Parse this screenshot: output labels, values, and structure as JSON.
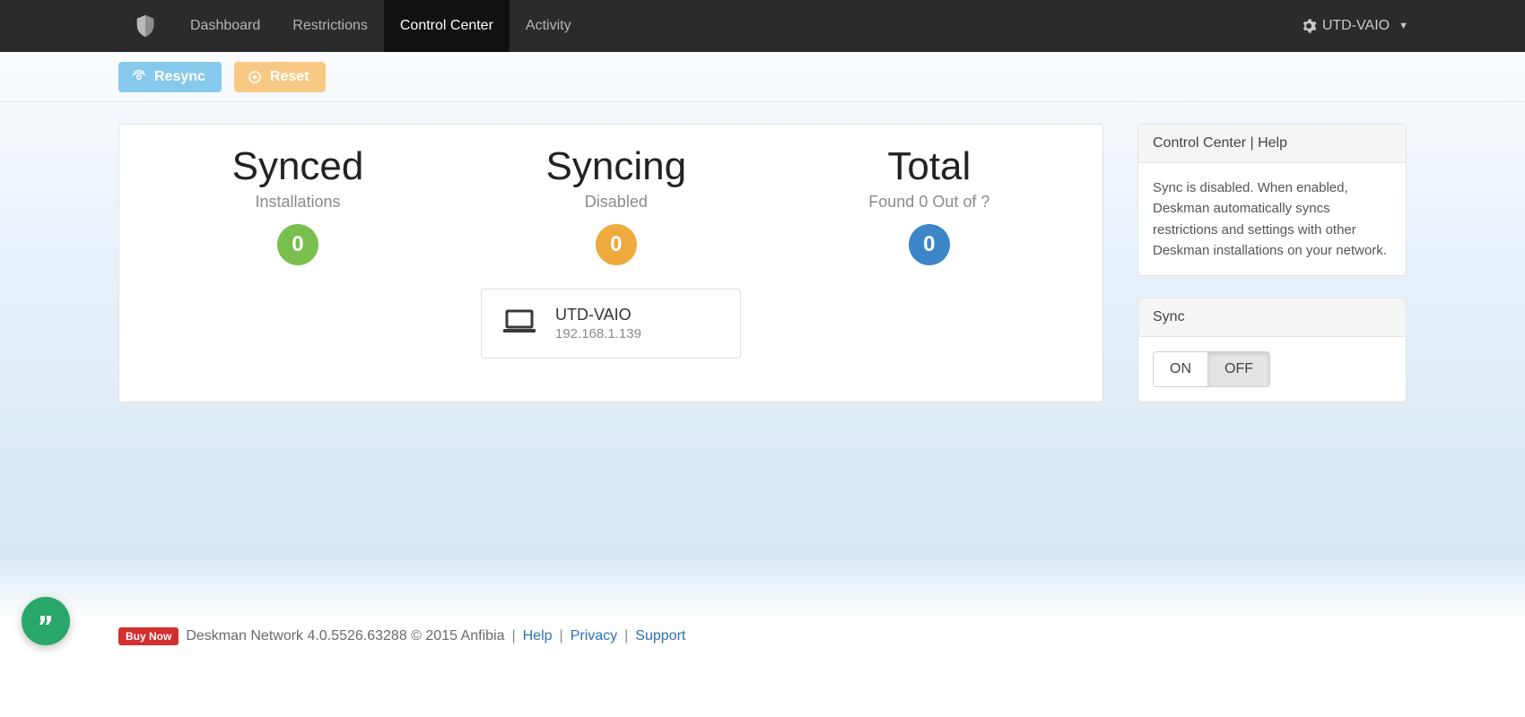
{
  "nav": {
    "items": [
      "Dashboard",
      "Restrictions",
      "Control Center",
      "Activity"
    ],
    "active_index": 2,
    "user_label": "UTD-VAIO"
  },
  "toolbar": {
    "resync_label": "Resync",
    "reset_label": "Reset"
  },
  "stats": {
    "synced": {
      "title": "Synced",
      "sub": "Installations",
      "value": "0"
    },
    "syncing": {
      "title": "Syncing",
      "sub": "Disabled",
      "value": "0"
    },
    "total": {
      "title": "Total",
      "sub": "Found 0 Out of ?",
      "value": "0"
    }
  },
  "device": {
    "name": "UTD-VAIO",
    "ip": "192.168.1.139"
  },
  "help_panel": {
    "title": "Control Center | Help",
    "body": "Sync is disabled. When enabled, Deskman automatically syncs restrictions and settings with other Deskman installations on your network."
  },
  "sync_panel": {
    "title": "Sync",
    "on": "ON",
    "off": "OFF",
    "active": "off"
  },
  "footer": {
    "buy_now": "Buy Now",
    "product": "Deskman Network 4.0.5526.63288 © 2015 Anfibia",
    "links": {
      "help": "Help",
      "privacy": "Privacy",
      "support": "Support"
    }
  }
}
